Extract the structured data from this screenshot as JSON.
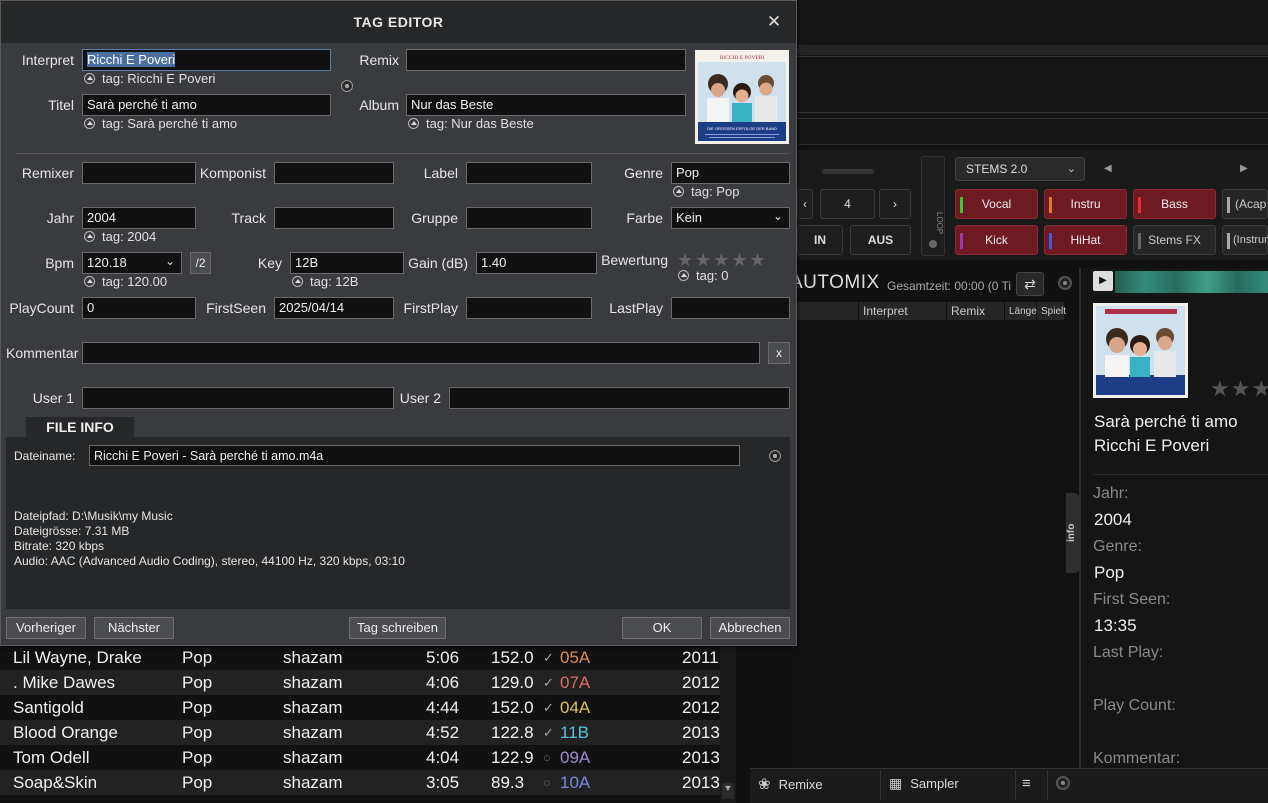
{
  "deck": {
    "stems_select": "STEMS 2.0",
    "stems_top": [
      "Vocal",
      "Instru",
      "Bass",
      "(Acap"
    ],
    "stems_bottom": [
      "Kick",
      "HiHat",
      "Stems FX",
      "(Instrum"
    ],
    "loop_value": "4",
    "loop_label": "LOOP",
    "in_label": "IN",
    "out_label": "AUS"
  },
  "automix": {
    "title": "AUTOMIX",
    "total_time": "Gesamtzeit: 00:00 (0 Ti",
    "columns": [
      "Interpret",
      "Remix",
      "Länge",
      "Spielt"
    ]
  },
  "info_panel": {
    "title": "Sarà perché ti amo",
    "artist": "Ricchi E Poveri",
    "year_label": "Jahr:",
    "year": "2004",
    "genre_label": "Genre:",
    "genre": "Pop",
    "first_seen_label": "First Seen:",
    "first_seen": "13:35",
    "last_play_label": "Last Play:",
    "play_count_label": "Play Count:",
    "comment_label": "Kommentar:",
    "tab_label": "info",
    "stars": "★★★"
  },
  "bottom_bar": {
    "remixes": "Remixe",
    "sampler": "Sampler"
  },
  "tracks": [
    {
      "artist": "Lil Wayne, Drake",
      "genre": "Pop",
      "source": "shazam",
      "length": "5:06",
      "bpm": "152.0",
      "checked": true,
      "key": "05A",
      "key_color": "#e08a5a",
      "year": "2011"
    },
    {
      "artist": ". Mike Dawes",
      "genre": "Pop",
      "source": "shazam",
      "length": "4:06",
      "bpm": "129.0",
      "checked": true,
      "key": "07A",
      "key_color": "#e06a6a",
      "year": "2012"
    },
    {
      "artist": "Santigold",
      "genre": "Pop",
      "source": "shazam",
      "length": "4:44",
      "bpm": "152.0",
      "checked": true,
      "key": "04A",
      "key_color": "#e0c05a",
      "year": "2012"
    },
    {
      "artist": "Blood Orange",
      "genre": "Pop",
      "source": "shazam",
      "length": "4:52",
      "bpm": "122.8",
      "checked": true,
      "key": "11B",
      "key_color": "#5ac0e0",
      "year": "2013"
    },
    {
      "artist": "Tom Odell",
      "genre": "Pop",
      "source": "shazam",
      "length": "4:04",
      "bpm": "122.9",
      "checked": false,
      "key": "09A",
      "key_color": "#a08ad0",
      "year": "2013"
    },
    {
      "artist": "Soap&Skin",
      "genre": "Pop",
      "source": "shazam",
      "length": "3:05",
      "bpm": "89.3",
      "checked": false,
      "key": "10A",
      "key_color": "#7a8ae0",
      "year": "2013"
    }
  ],
  "dialog": {
    "title": "TAG EDITOR",
    "labels": {
      "interpret": "Interpret",
      "remix": "Remix",
      "titel": "Titel",
      "album": "Album",
      "remixer": "Remixer",
      "komponist": "Komponist",
      "label": "Label",
      "genre": "Genre",
      "jahr": "Jahr",
      "track": "Track",
      "gruppe": "Gruppe",
      "farbe": "Farbe",
      "bpm": "Bpm",
      "key": "Key",
      "gain": "Gain (dB)",
      "bewertung": "Bewertung",
      "playcount": "PlayCount",
      "firstseen": "FirstSeen",
      "firstplay": "FirstPlay",
      "lastplay": "LastPlay",
      "kommentar": "Kommentar",
      "user1": "User 1",
      "user2": "User 2"
    },
    "values": {
      "interpret": "Ricchi E Poveri",
      "remix": "",
      "titel": "Sarà perché ti amo",
      "album": "Nur das Beste",
      "remixer": "",
      "komponist": "",
      "label": "",
      "genre": "Pop",
      "jahr": "2004",
      "track": "",
      "gruppe": "",
      "farbe": "Kein",
      "bpm": "120.18",
      "key": "12B",
      "gain": "1.40",
      "playcount": "0",
      "firstseen": "2025/04/14",
      "firstplay": "",
      "lastplay": "",
      "kommentar": "",
      "user1": "",
      "user2": ""
    },
    "tags": {
      "interpret": "tag: Ricchi E Poveri",
      "titel": "tag: Sarà perché ti amo",
      "album": "tag: Nur das Beste",
      "genre": "tag: Pop",
      "jahr": "tag: 2004",
      "bpm": "tag: 120.00",
      "key": "tag: 12B",
      "bewertung": "tag: 0"
    },
    "bpm_half": "/2",
    "comment_clear": "x",
    "stars": "★★★★★",
    "file_info": {
      "tab": "FILE INFO",
      "filename_label": "Dateiname:",
      "filename": "Ricchi E Poveri - Sarà perché ti amo.m4a",
      "path": "Dateipfad: D:\\Musik\\my Music",
      "size": "Dateigrösse: 7.31 MB",
      "bitrate": "Bitrate: 320 kbps",
      "audio": "Audio: AAC (Advanced Audio Coding), stereo, 44100 Hz, 320 kbps, 03:10"
    },
    "buttons": {
      "prev": "Vorheriger",
      "next": "Nächster",
      "write": "Tag schreiben",
      "ok": "OK",
      "cancel": "Abbrechen"
    }
  },
  "cover_art": {
    "brand": "RICCHI E POVERI",
    "caption": "DIE GROSSEN ERFOLGE DER BAND"
  },
  "colors": {
    "stem_red": "#6e1a22",
    "vocal": "#3cc83c",
    "instru": "#e07a2a",
    "bass": "#e03030",
    "kick": "#9a3aa8",
    "hihat": "#3a5ae0"
  }
}
